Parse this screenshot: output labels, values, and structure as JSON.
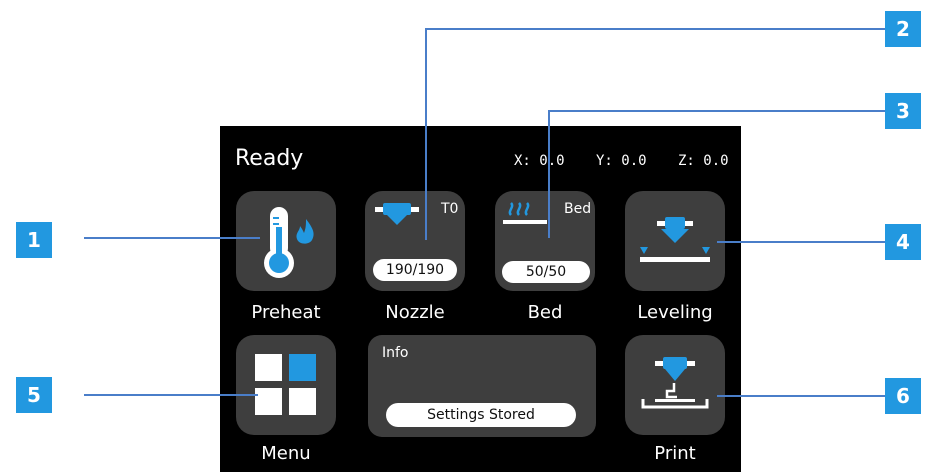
{
  "status": {
    "text": "Ready"
  },
  "coords": {
    "x": "X: 0.0",
    "y": "Y: 0.0",
    "z": "Z: 0.0"
  },
  "buttons": {
    "preheat": {
      "label": "Preheat"
    },
    "nozzle": {
      "label": "Nozzle",
      "tag": "T0",
      "temp": "190/190"
    },
    "bed": {
      "label": "Bed",
      "tag": "Bed",
      "temp": "50/50"
    },
    "leveling": {
      "label": "Leveling"
    },
    "menu": {
      "label": "Menu"
    },
    "print": {
      "label": "Print"
    }
  },
  "info": {
    "title": "Info",
    "message": "Settings Stored"
  },
  "callouts": [
    "1",
    "2",
    "3",
    "4",
    "5",
    "6"
  ],
  "colors": {
    "accent": "#2298e0",
    "callout_line": "#4a7ec9",
    "panel": "#3e3e3e",
    "screen": "#000000"
  }
}
